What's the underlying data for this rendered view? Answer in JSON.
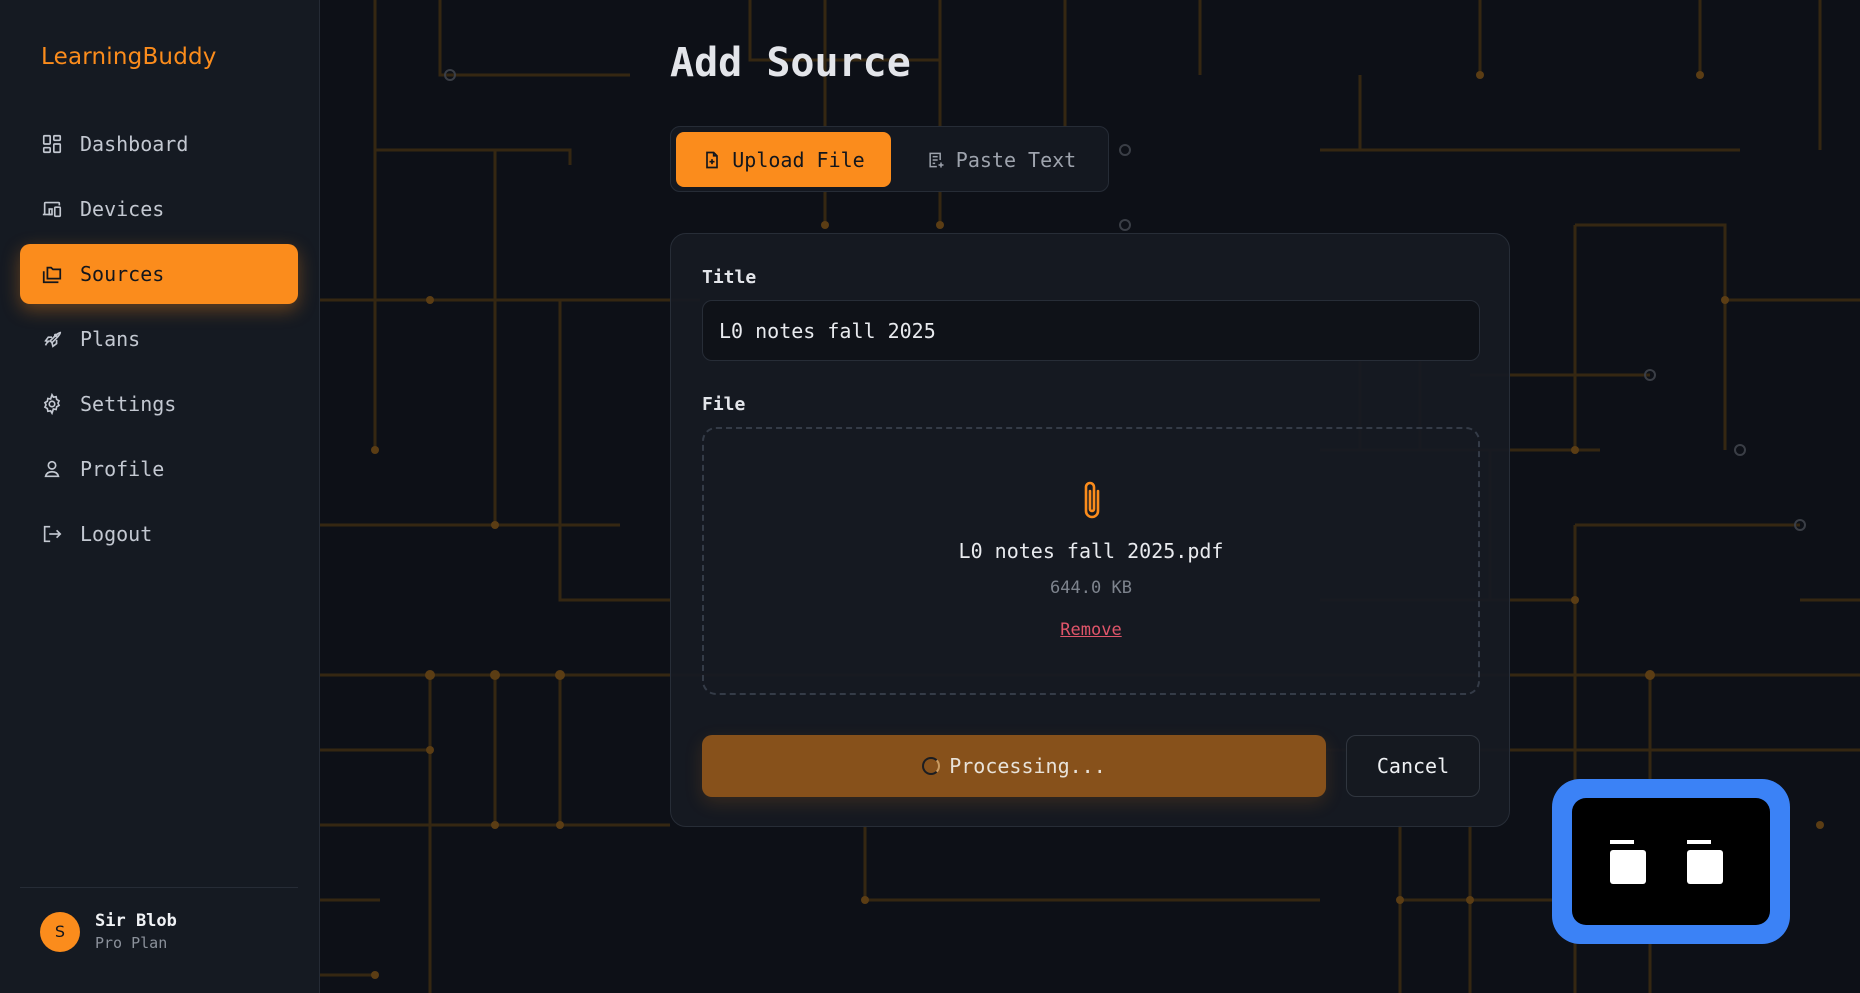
{
  "app": {
    "brand": "LearningBuddy"
  },
  "sidebar": {
    "items": [
      {
        "label": "Dashboard",
        "icon": "dashboard-icon",
        "active": false
      },
      {
        "label": "Devices",
        "icon": "devices-icon",
        "active": false
      },
      {
        "label": "Sources",
        "icon": "folders-icon",
        "active": true
      },
      {
        "label": "Plans",
        "icon": "rocket-icon",
        "active": false
      },
      {
        "label": "Settings",
        "icon": "gear-icon",
        "active": false
      },
      {
        "label": "Profile",
        "icon": "user-icon",
        "active": false
      },
      {
        "label": "Logout",
        "icon": "logout-icon",
        "active": false
      }
    ],
    "user": {
      "initial": "S",
      "name": "Sir Blob",
      "plan": "Pro Plan"
    }
  },
  "main": {
    "title": "Add Source",
    "tabs": [
      {
        "label": "Upload File",
        "icon": "file-upload-icon",
        "active": true
      },
      {
        "label": "Paste Text",
        "icon": "paste-text-icon",
        "active": false
      }
    ],
    "form": {
      "title_label": "Title",
      "title_value": "L0 notes fall 2025",
      "file_label": "File",
      "file": {
        "name": "L0 notes fall 2025.pdf",
        "size": "644.0 KB",
        "remove_label": "Remove"
      },
      "submit_label": "Processing...",
      "cancel_label": "Cancel"
    }
  },
  "colors": {
    "accent": "#fb8c1c",
    "background": "#0d1017",
    "sidebar": "#151a22",
    "danger": "#e0556a",
    "robot_frame": "#3b82f6"
  }
}
